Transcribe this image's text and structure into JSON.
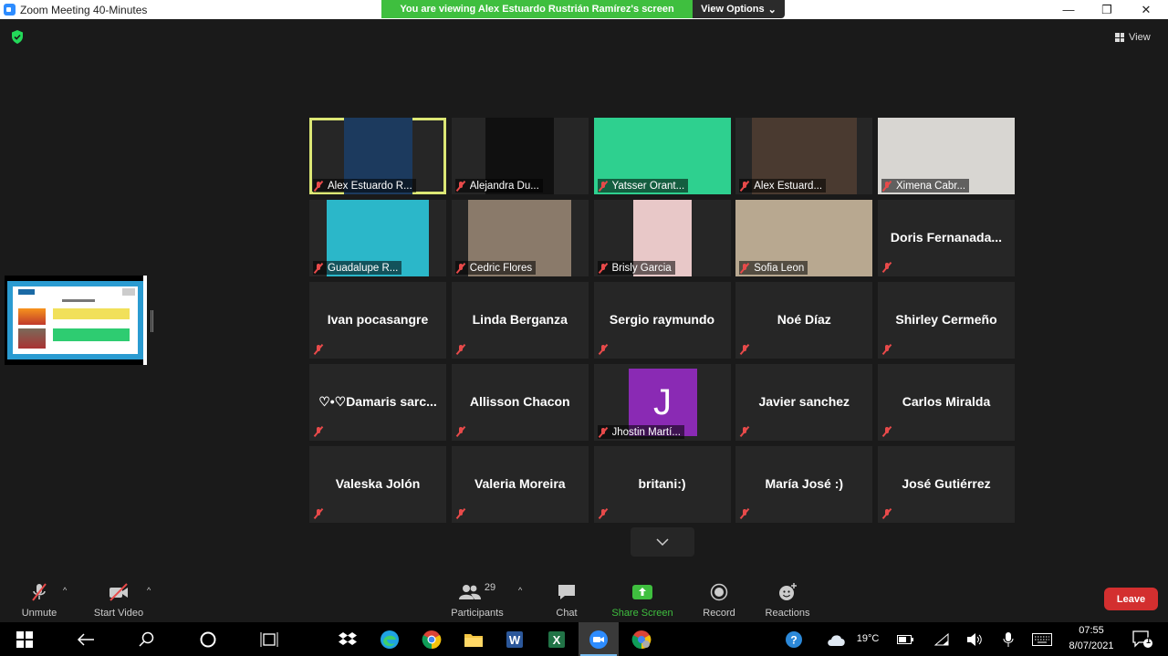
{
  "window": {
    "title": "Zoom Meeting 40-Minutes",
    "minimize": "—",
    "restore": "❐",
    "close": "✕"
  },
  "share_banner": {
    "text": "You are viewing Alex Estuardo Rustrián Ramírez's screen",
    "view_options": "View Options",
    "view_options_caret": "⌄"
  },
  "view_label": "View",
  "tiles": [
    {
      "name": "Alex Estuardo R...",
      "video": true,
      "active": true,
      "video_bg": "#1c3a5e"
    },
    {
      "name": "Alejandra Du...",
      "video": true,
      "video_bg": "#101010"
    },
    {
      "name": "Yatsser Orant...",
      "video": true,
      "video_bg": "#2ed08f"
    },
    {
      "name": "Alex Estuard...",
      "video": true,
      "video_bg": "#4a3a30"
    },
    {
      "name": "Ximena Cabr...",
      "video": true,
      "video_bg": "#d8d6d2"
    },
    {
      "name": "Guadalupe R...",
      "video": true,
      "video_bg": "#2bb7c9"
    },
    {
      "name": "Cedric Flores",
      "video": true,
      "video_bg": "#8a7a6a"
    },
    {
      "name": "Brisly Garcia",
      "video": true,
      "video_bg": "#e8c8c8"
    },
    {
      "name": "Sofia Leon",
      "video": true,
      "video_bg": "#b8a890"
    },
    {
      "name": "Doris  Fernanada..."
    },
    {
      "name": "Ivan pocasangre"
    },
    {
      "name": "Linda Berganza"
    },
    {
      "name": "Sergio raymundo"
    },
    {
      "name": "Noé Díaz"
    },
    {
      "name": "Shirley Cermeño"
    },
    {
      "name": "♡•♡Damaris  sarc..."
    },
    {
      "name": "Allisson Chacon"
    },
    {
      "name": "Jhostin Martí...",
      "avatar": "J",
      "avatar_color": "#8a2ab4"
    },
    {
      "name": "Javier sanchez"
    },
    {
      "name": "Carlos Miralda"
    },
    {
      "name": "Valeska Jolón"
    },
    {
      "name": "Valeria Moreira"
    },
    {
      "name": "britani:)"
    },
    {
      "name": "María José :)"
    },
    {
      "name": "José Gutiérrez"
    }
  ],
  "toolbar": {
    "unmute": "Unmute",
    "start_video": "Start Video",
    "participants": "Participants",
    "participants_count": "29",
    "chat": "Chat",
    "share_screen": "Share Screen",
    "record": "Record",
    "reactions": "Reactions",
    "leave": "Leave"
  },
  "taskbar": {
    "temperature": "19°C",
    "time": "07:55",
    "date": "8/07/2021",
    "notifications": "1"
  },
  "colors": {
    "banner": "#3fbf3f",
    "active_speaker": "#dce775",
    "leave": "#d32f2f",
    "muted": "#e84a4a"
  }
}
